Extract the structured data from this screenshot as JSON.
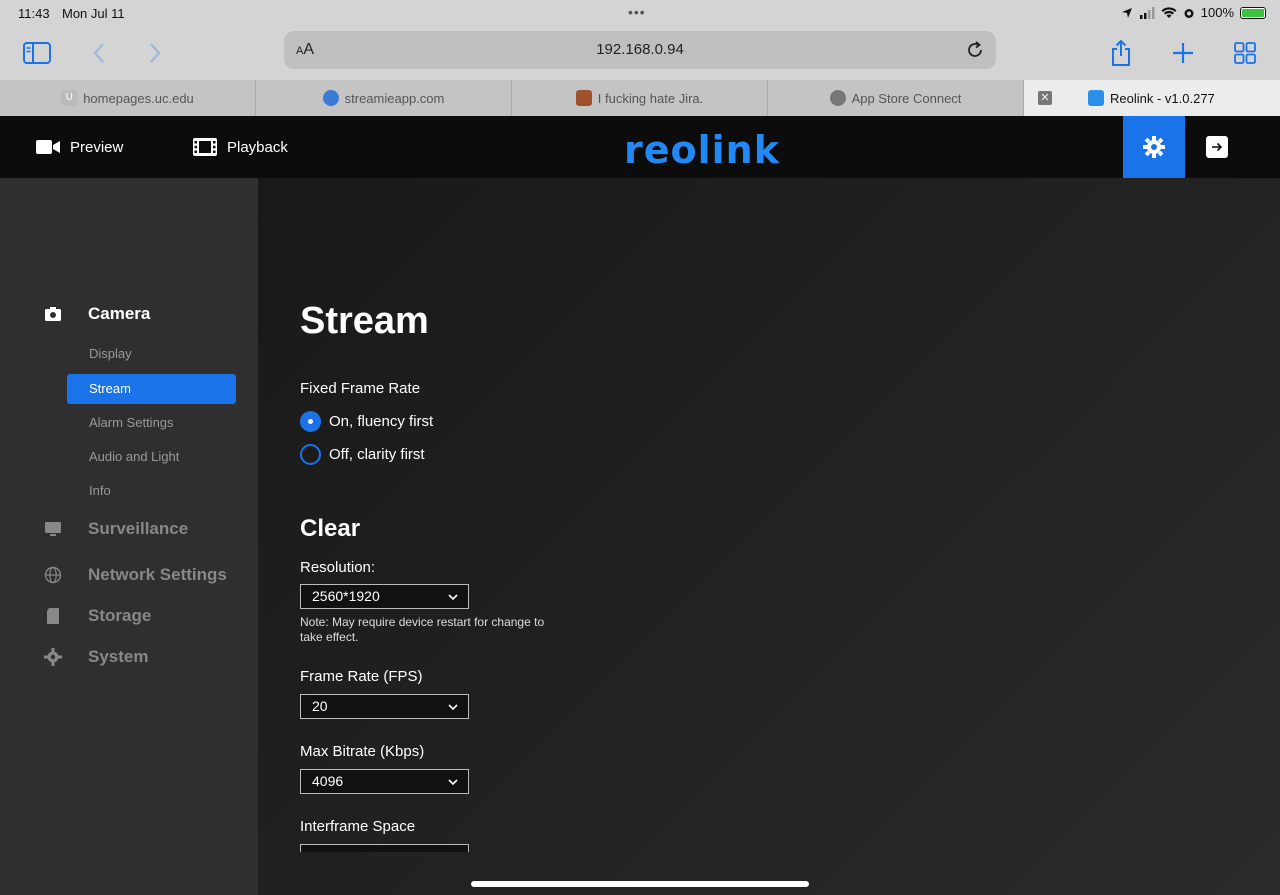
{
  "status": {
    "time": "11:43",
    "date": "Mon Jul 11",
    "battery": "100%"
  },
  "browser": {
    "address": "192.168.0.94",
    "aa_small": "A",
    "aa_large": "A",
    "tabs": [
      {
        "label": "homepages.uc.edu",
        "favicon": "U"
      },
      {
        "label": "streamieapp.com",
        "favicon": ""
      },
      {
        "label": "I fucking hate Jira.",
        "favicon": ""
      },
      {
        "label": "App Store Connect",
        "favicon": ""
      },
      {
        "label": "Reolink - v1.0.277",
        "favicon": ""
      }
    ]
  },
  "header": {
    "preview": "Preview",
    "playback": "Playback",
    "logo": "reolink"
  },
  "sidebar": {
    "camera": "Camera",
    "camera_items": [
      "Display",
      "Stream",
      "Alarm Settings",
      "Audio and Light",
      "Info"
    ],
    "surveillance": "Surveillance",
    "network": "Network Settings",
    "storage": "Storage",
    "system": "System"
  },
  "main": {
    "title": "Stream",
    "fixed_frame_rate_label": "Fixed Frame Rate",
    "radio_on": "On, fluency first",
    "radio_off": "Off, clarity first",
    "clear_title": "Clear",
    "resolution_label": "Resolution:",
    "resolution_value": "2560*1920",
    "note": "Note: May require device restart for change to take effect.",
    "fps_label": "Frame Rate (FPS)",
    "fps_value": "20",
    "bitrate_label": "Max Bitrate (Kbps)",
    "bitrate_value": "4096",
    "interframe_label": "Interframe Space"
  },
  "colors": {
    "accent": "#1a73e8",
    "logo": "#2289f4",
    "sidebar": "#2f2f2f"
  }
}
